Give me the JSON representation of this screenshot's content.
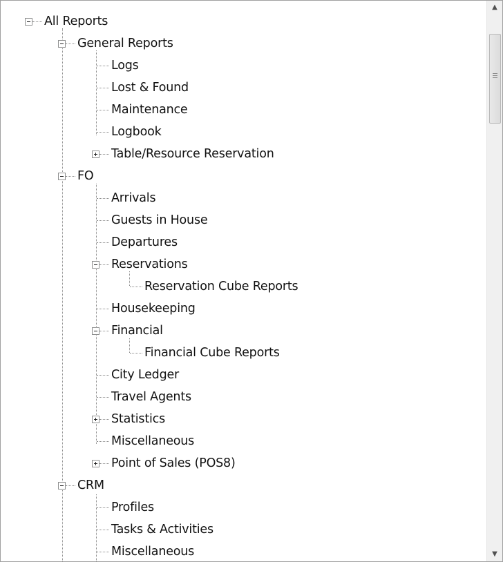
{
  "tree": {
    "root": "All Reports",
    "general_reports": {
      "label": "General Reports",
      "items": [
        "Logs",
        "Lost & Found",
        "Maintenance",
        "Logbook",
        "Table/Resource Reservation"
      ]
    },
    "fo": {
      "label": "FO",
      "arrivals": "Arrivals",
      "guests_in_house": "Guests in House",
      "departures": "Departures",
      "reservations": "Reservations",
      "reservation_cube_reports": "Reservation Cube Reports",
      "housekeeping": "Housekeeping",
      "financial": "Financial",
      "financial_cube_reports": "Financial Cube Reports",
      "city_ledger": "City Ledger",
      "travel_agents": "Travel Agents",
      "statistics": "Statistics",
      "miscellaneous": "Miscellaneous",
      "point_of_sales": "Point of Sales (POS8)"
    },
    "crm": {
      "label": "CRM",
      "items": [
        "Profiles",
        "Tasks & Activities",
        "Miscellaneous"
      ]
    }
  },
  "scrollbar": {
    "up_icon": "arrow-up",
    "down_icon": "arrow-down"
  }
}
